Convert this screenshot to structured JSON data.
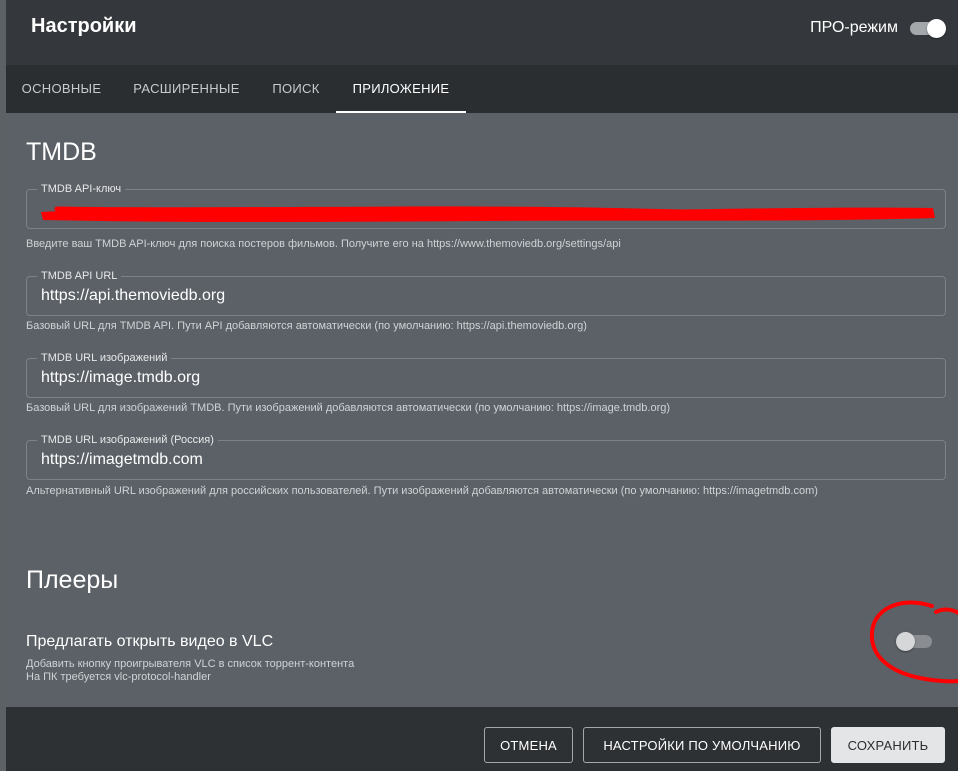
{
  "header": {
    "title": "Настройки",
    "pro_mode_label": "ПРО-режим",
    "pro_mode_on": true
  },
  "tabs": [
    {
      "label": "ОСНОВНЫЕ",
      "active": false
    },
    {
      "label": "РАСШИРЕННЫЕ",
      "active": false
    },
    {
      "label": "ПОИСК",
      "active": false
    },
    {
      "label": "ПРИЛОЖЕНИЕ",
      "active": true
    }
  ],
  "tmdb": {
    "section_title": "TMDB",
    "api_key": {
      "label": "TMDB API-ключ",
      "value": "",
      "redacted": true,
      "helper": "Введите ваш TMDB API-ключ для поиска постеров фильмов. Получите его на https://www.themoviedb.org/settings/api"
    },
    "api_url": {
      "label": "TMDB API URL",
      "value": "https://api.themoviedb.org",
      "helper": "Базовый URL для TMDB API. Пути API добавляются автоматически (по умолчанию: https://api.themoviedb.org)"
    },
    "image_url": {
      "label": "TMDB URL изображений",
      "value": "https://image.tmdb.org",
      "helper": "Базовый URL для изображений TMDB. Пути изображений добавляются автоматически (по умолчанию: https://image.tmdb.org)"
    },
    "image_url_ru": {
      "label": "TMDB URL изображений (Россия)",
      "value": "https://imagetmdb.com",
      "helper": "Альтернативный URL изображений для российских пользователей. Пути изображений добавляются автоматически (по умолчанию: https://imagetmdb.com)"
    }
  },
  "players": {
    "section_title": "Плееры",
    "vlc": {
      "title": "Предлагать открыть видео в VLC",
      "desc_line1": "Добавить кнопку проигрывателя VLC в список торрент-контента",
      "desc_line2": "На ПК требуется vlc-protocol-handler",
      "enabled": false
    }
  },
  "footer": {
    "cancel_label": "ОТМЕНА",
    "defaults_label": "НАСТРОЙКИ ПО УМОЛЧАНИЮ",
    "save_label": "СОХРАНИТЬ"
  },
  "colors": {
    "annotation_red": "#ff0000",
    "header_bg": "#34383c",
    "tabs_bg": "#2b2e31",
    "content_bg": "#5b6167",
    "footer_bg": "#2e3134"
  }
}
